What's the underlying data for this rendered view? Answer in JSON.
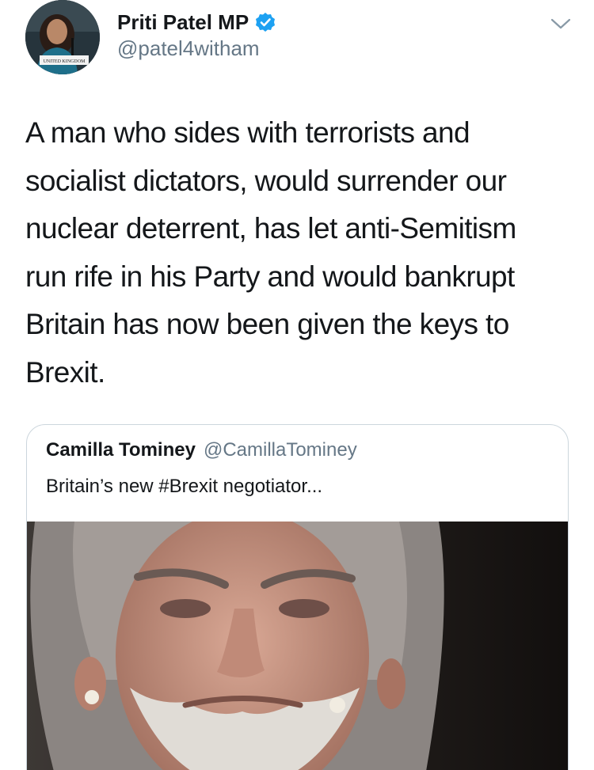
{
  "tweet": {
    "author": {
      "display_name": "Priti Patel MP",
      "handle": "@patel4witham",
      "verified": true,
      "avatar_caption": "UNITED KINGDOM"
    },
    "text": "A man who sides with terrorists and\nsocialist dictators, would surrender our\nnuclear deterrent, has let anti-Semitism\nrun rife in his Party and would bankrupt\nBritain has now been given the keys to\nBrexit.",
    "menu_icon": "chevron-down-icon"
  },
  "quoted_tweet": {
    "display_name": "Camilla Tominey",
    "handle": "@CamillaTominey",
    "text": "Britain’s new #Brexit negotiator...",
    "media": "photo"
  },
  "colors": {
    "text_primary": "#14171a",
    "text_secondary": "#657786",
    "verified_blue": "#1da1f2",
    "border": "#ccd6dd"
  }
}
